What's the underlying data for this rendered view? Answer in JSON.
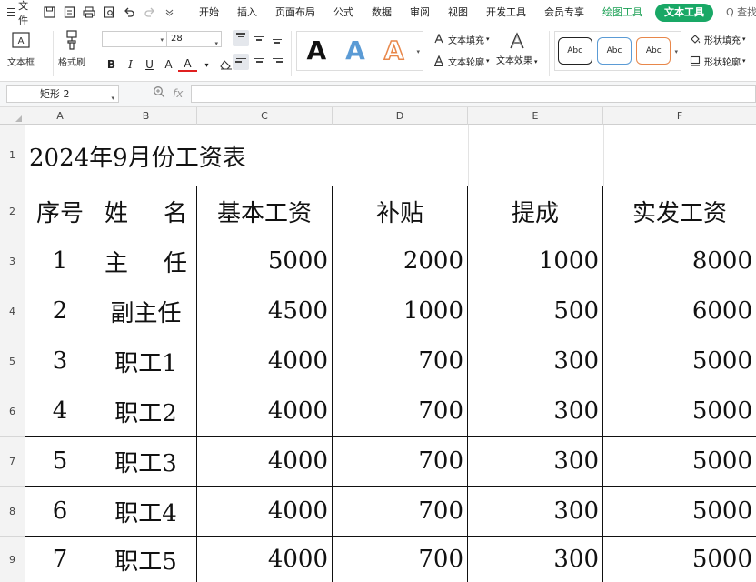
{
  "menubar": {
    "file_label": "文件",
    "tabs": [
      {
        "label": "开始"
      },
      {
        "label": "插入"
      },
      {
        "label": "页面布局"
      },
      {
        "label": "公式"
      },
      {
        "label": "数据"
      },
      {
        "label": "审阅"
      },
      {
        "label": "视图"
      },
      {
        "label": "开发工具"
      },
      {
        "label": "会员专享"
      },
      {
        "label": "绘图工具"
      },
      {
        "label": "文本工具"
      },
      {
        "label": "Q 查找"
      }
    ]
  },
  "ribbon": {
    "textbox_label": "文本框",
    "format_painter_label": "格式刷",
    "font_name": "",
    "font_size": "28",
    "bold": "B",
    "italic": "I",
    "underline": "U",
    "strike": "A",
    "font_color": "A",
    "wordart": [
      "A",
      "A",
      "A"
    ],
    "text_fill_label": "文本填充",
    "text_outline_label": "文本轮廓",
    "text_effect_label": "文本效果",
    "shape_styles": [
      "Abc",
      "Abc",
      "Abc"
    ],
    "shape_fill_label": "形状填充",
    "shape_outline_label": "形状轮廓"
  },
  "formula": {
    "name_box": "矩形 2",
    "fx": "fx",
    "value": ""
  },
  "columns": [
    "A",
    "B",
    "C",
    "D",
    "E",
    "F"
  ],
  "rows": [
    "1",
    "2",
    "3",
    "4",
    "5",
    "6",
    "7",
    "8",
    "9"
  ],
  "sheet": {
    "title": "2024年9月份工资表",
    "headers": [
      "序号",
      "姓名",
      "基本工资",
      "补贴",
      "提成",
      "实发工资"
    ],
    "header_name_chars": [
      "姓",
      "名"
    ],
    "rows": [
      {
        "no": "1",
        "name": "主任",
        "name_chars": [
          "主",
          "任"
        ],
        "base": "5000",
        "allowance": "2000",
        "commission": "1000",
        "total": "8000"
      },
      {
        "no": "2",
        "name": "副主任",
        "base": "4500",
        "allowance": "1000",
        "commission": "500",
        "total": "6000"
      },
      {
        "no": "3",
        "name": "职工1",
        "base": "4000",
        "allowance": "700",
        "commission": "300",
        "total": "5000"
      },
      {
        "no": "4",
        "name": "职工2",
        "base": "4000",
        "allowance": "700",
        "commission": "300",
        "total": "5000"
      },
      {
        "no": "5",
        "name": "职工3",
        "base": "4000",
        "allowance": "700",
        "commission": "300",
        "total": "5000"
      },
      {
        "no": "6",
        "name": "职工4",
        "base": "4000",
        "allowance": "700",
        "commission": "300",
        "total": "5000"
      },
      {
        "no": "7",
        "name": "职工5",
        "base": "4000",
        "allowance": "700",
        "commission": "300",
        "total": "5000"
      }
    ]
  },
  "colors": {
    "accent_green": "#19a866",
    "wordart_blue": "#5b9bd5",
    "wordart_orange": "#e8874a"
  }
}
